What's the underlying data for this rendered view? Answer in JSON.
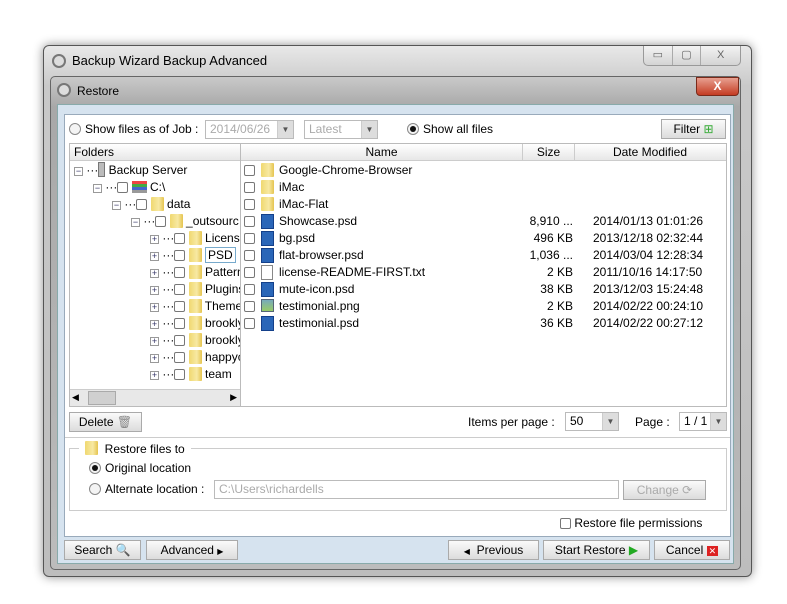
{
  "window": {
    "title": "Backup Wizard Backup Advanced",
    "controls": [
      "▭",
      "▢",
      "X"
    ]
  },
  "dialog": {
    "title": "Restore",
    "close": "X"
  },
  "options": {
    "show_as_of_job": "Show files as of Job :",
    "job_date": "2014/06/26",
    "job_version": "Latest",
    "show_all": "Show all files",
    "selected": "show_all",
    "filter": "Filter"
  },
  "tree": {
    "header": "Folders",
    "items": [
      {
        "label": "Backup Server",
        "level": 0,
        "icon": "server-icon",
        "toggle": "−"
      },
      {
        "label": "C:\\",
        "level": 1,
        "icon": "drive-icon",
        "toggle": "−"
      },
      {
        "label": "data",
        "level": 2,
        "icon": "folder-icon",
        "toggle": "−"
      },
      {
        "label": "_outsourc",
        "level": 3,
        "icon": "folder-icon",
        "toggle": "−"
      },
      {
        "label": "Licens",
        "level": 4,
        "icon": "folder-icon",
        "toggle": "+"
      },
      {
        "label": "PSD",
        "level": 4,
        "icon": "folder-icon",
        "toggle": "+",
        "selected": true
      },
      {
        "label": "Pattern",
        "level": 4,
        "icon": "folder-icon",
        "toggle": "+"
      },
      {
        "label": "Plugins",
        "level": 4,
        "icon": "folder-icon",
        "toggle": "+"
      },
      {
        "label": "Theme",
        "level": 4,
        "icon": "folder-icon",
        "toggle": "+"
      },
      {
        "label": "brookly",
        "level": 4,
        "icon": "folder-icon",
        "toggle": "+"
      },
      {
        "label": "brookly",
        "level": 4,
        "icon": "folder-icon",
        "toggle": "+"
      },
      {
        "label": "happyc",
        "level": 4,
        "icon": "folder-icon",
        "toggle": "+"
      },
      {
        "label": "team",
        "level": 4,
        "icon": "folder-icon",
        "toggle": "+"
      }
    ]
  },
  "files": {
    "columns": [
      "Name",
      "Size",
      "Date Modified"
    ],
    "rows": [
      {
        "name": "Google-Chrome-Browser",
        "size": "",
        "date": "",
        "icon": "folder"
      },
      {
        "name": "iMac",
        "size": "",
        "date": "",
        "icon": "folder"
      },
      {
        "name": "iMac-Flat",
        "size": "",
        "date": "",
        "icon": "folder"
      },
      {
        "name": "Showcase.psd",
        "size": "8,910 ...",
        "date": "2014/01/13 01:01:26",
        "icon": "psd"
      },
      {
        "name": "bg.psd",
        "size": "496 KB",
        "date": "2013/12/18 02:32:44",
        "icon": "psd"
      },
      {
        "name": "flat-browser.psd",
        "size": "1,036 ...",
        "date": "2014/03/04 12:28:34",
        "icon": "psd"
      },
      {
        "name": "license-README-FIRST.txt",
        "size": "2 KB",
        "date": "2011/10/16 14:17:50",
        "icon": "txt"
      },
      {
        "name": "mute-icon.psd",
        "size": "38 KB",
        "date": "2013/12/03 15:24:48",
        "icon": "psd"
      },
      {
        "name": "testimonial.png",
        "size": "2 KB",
        "date": "2014/02/22 00:24:10",
        "icon": "png"
      },
      {
        "name": "testimonial.psd",
        "size": "36 KB",
        "date": "2014/02/22 00:27:12",
        "icon": "psd"
      }
    ]
  },
  "paging": {
    "delete": "Delete",
    "items_per_page_label": "Items per page :",
    "items_per_page": "50",
    "page_label": "Page :",
    "page": "1 / 1"
  },
  "restore_to": {
    "title": "Restore files to",
    "original": "Original location",
    "alternate": "Alternate location :",
    "alternate_path": "C:\\Users\\richardells",
    "change": "Change",
    "selected": "original",
    "permissions": "Restore file permissions"
  },
  "footer": {
    "search": "Search",
    "advanced": "Advanced",
    "previous": "Previous",
    "start": "Start Restore",
    "cancel": "Cancel"
  }
}
